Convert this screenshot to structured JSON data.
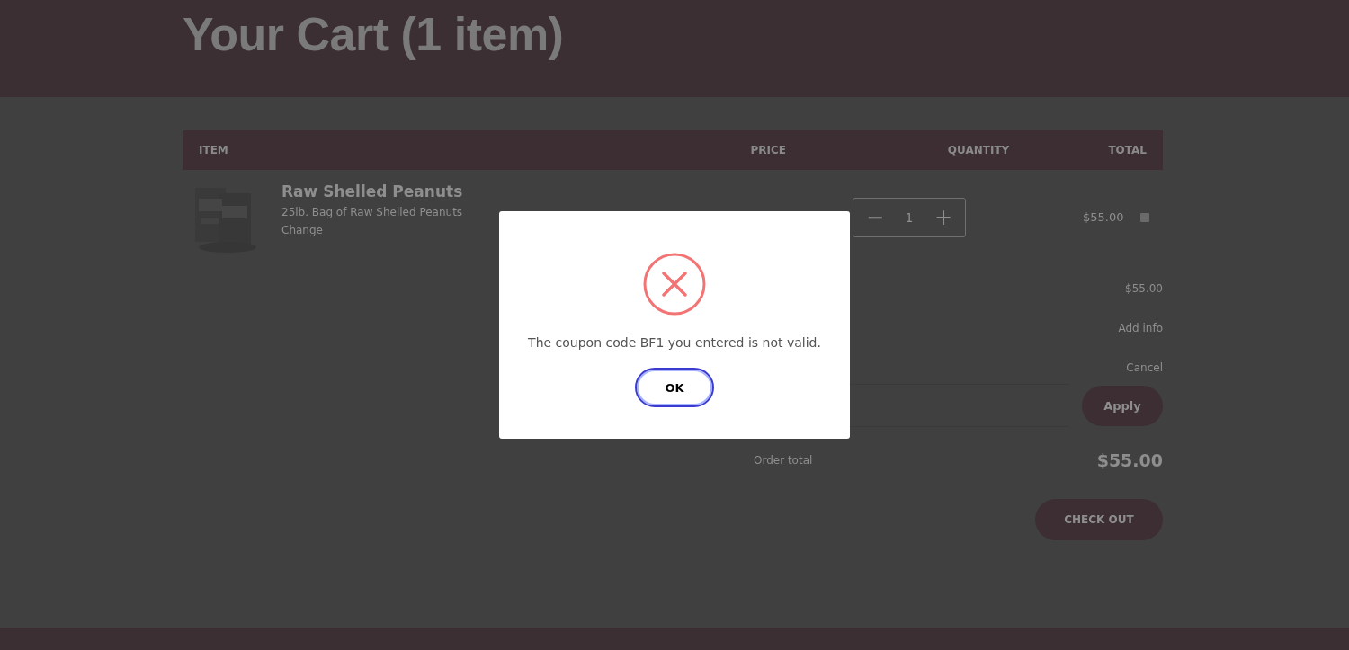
{
  "header": {
    "title": "Your Cart (1 item)"
  },
  "table": {
    "columns": [
      "ITEM",
      "PRICE",
      "QUANTITY",
      "TOTAL"
    ],
    "rows": [
      {
        "name": "Raw Shelled Peanuts",
        "variant": "25lb. Bag of Raw Shelled Peanuts",
        "change": "Change",
        "quantity": "1",
        "decrement": "−",
        "increment": "+",
        "total": "$55.00"
      }
    ]
  },
  "summary": {
    "subtotal": "$55.00",
    "add_info": "Add info",
    "cancel": "Cancel",
    "apply": "Apply",
    "order_total_label": "Order total",
    "order_total": "$55.00",
    "checkout": "CHECK OUT"
  },
  "dialog": {
    "message": "The coupon code BF1 you entered is not valid.",
    "ok": "OK"
  }
}
